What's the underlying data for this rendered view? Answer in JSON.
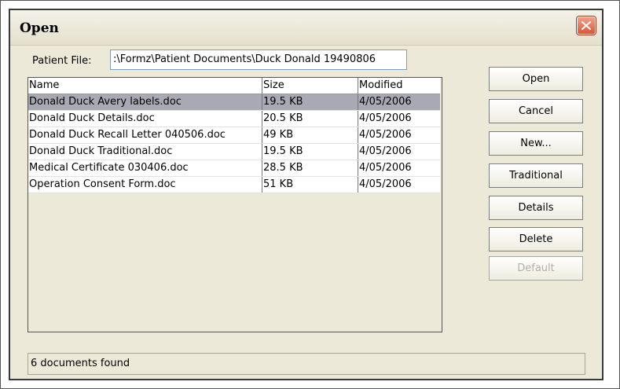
{
  "window": {
    "title": "Open"
  },
  "patient_file": {
    "label": "Patient File:",
    "value": ":\\Formz\\Patient Documents\\Duck Donald 19490806"
  },
  "file_list": {
    "columns": {
      "name": "Name",
      "size": "Size",
      "modified": "Modified"
    },
    "rows": [
      {
        "name": "Donald Duck Avery labels.doc",
        "size": "19.5 KB",
        "modified": "4/05/2006",
        "selected": true
      },
      {
        "name": "Donald Duck Details.doc",
        "size": "20.5 KB",
        "modified": "4/05/2006"
      },
      {
        "name": "Donald Duck Recall Letter 040506.doc",
        "size": "49 KB",
        "modified": "4/05/2006"
      },
      {
        "name": "Donald Duck Traditional.doc",
        "size": "19.5 KB",
        "modified": "4/05/2006"
      },
      {
        "name": "Medical Certificate 030406.doc",
        "size": "28.5 KB",
        "modified": "4/05/2006"
      },
      {
        "name": "Operation Consent Form.doc",
        "size": "51 KB",
        "modified": "4/05/2006"
      }
    ]
  },
  "buttons": {
    "open": "Open",
    "cancel": "Cancel",
    "new": "New...",
    "traditional": "Traditional",
    "details": "Details",
    "delete": "Delete",
    "default": "Default"
  },
  "status": {
    "text": "6 documents found"
  },
  "icons": {
    "close": "close-icon"
  },
  "colors": {
    "close_button": "#d9573a",
    "selection": "#a9a9b4",
    "window_bg": "#ece9d8"
  }
}
